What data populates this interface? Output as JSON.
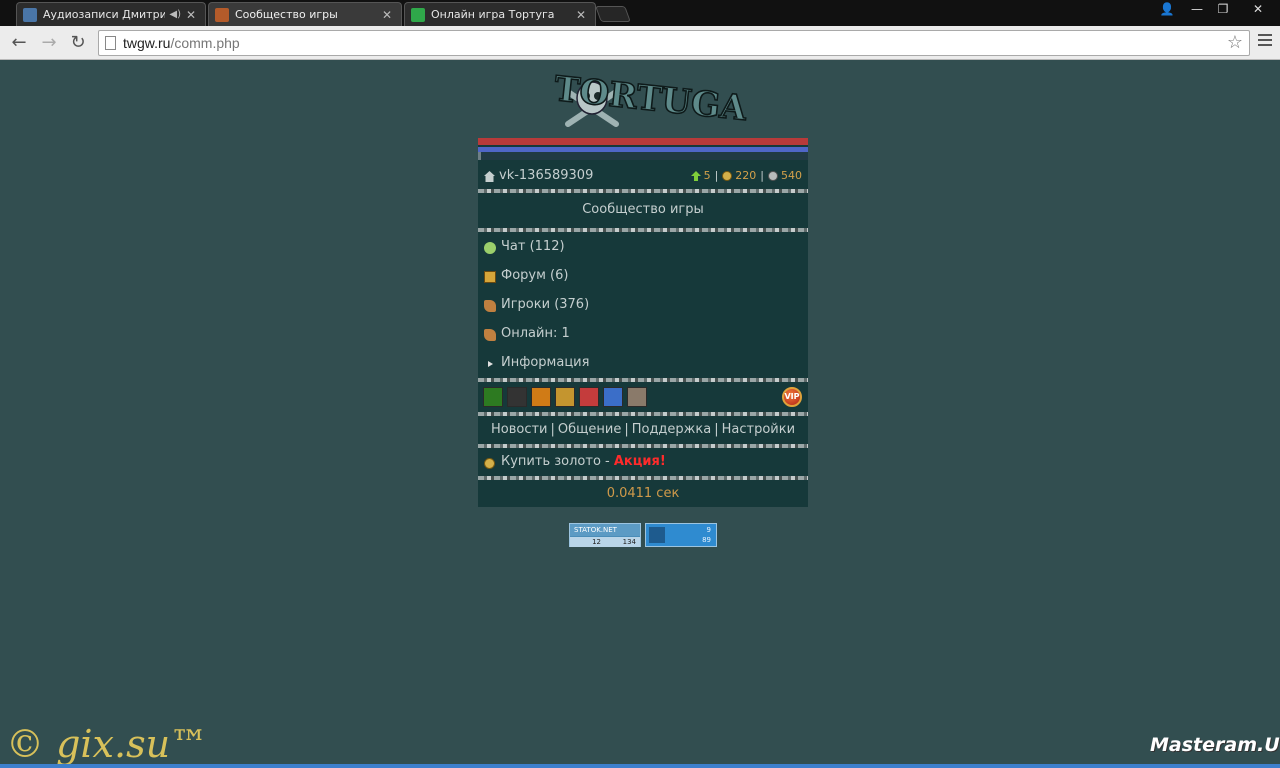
{
  "browser": {
    "tabs": [
      {
        "title": "Аудиозаписи Дмитрия К",
        "favicon_color": "#4a76a8",
        "active": false,
        "audio": true
      },
      {
        "title": "Сообщество игры",
        "favicon_color": "#b45b2a",
        "active": true,
        "audio": false
      },
      {
        "title": "Онлайн игра Тортуга",
        "favicon_color": "#2fa84a",
        "active": false,
        "audio": false
      }
    ],
    "close_glyph": "✕",
    "audio_glyph": "◀)",
    "url_domain": "twgw.ru",
    "url_path": "/comm.php",
    "window_controls": [
      "👤",
      "—",
      "❐",
      "✕"
    ]
  },
  "game": {
    "logo_text": "TORTUGA",
    "user": {
      "name": "vk-136589309",
      "level": "5",
      "gold": "220",
      "silver": "540"
    },
    "section_title": "Сообщество игры",
    "menu": [
      {
        "label": "Чат (112)",
        "icon": "chat-icon",
        "color": "#9bcf6b"
      },
      {
        "label": "Форум (6)",
        "icon": "forum-icon",
        "color": "#d6a63a"
      },
      {
        "label": "Игроки (376)",
        "icon": "scroll-icon",
        "color": "#c08040"
      },
      {
        "label": "Онлайн: 1",
        "icon": "scroll-icon",
        "color": "#c08040"
      },
      {
        "label": "Информация",
        "icon": "arrow-icon",
        "color": "#e0e0e0"
      }
    ],
    "badges": [
      {
        "name": "badge-green-warrior",
        "color": "#2d7a21"
      },
      {
        "name": "badge-pirate-skull",
        "color": "#333"
      },
      {
        "name": "badge-sun-orange",
        "color": "#d07b16"
      },
      {
        "name": "badge-gold-shield",
        "color": "#c4952f"
      },
      {
        "name": "badge-red-star",
        "color": "#c43c3c"
      },
      {
        "name": "badge-blue-star",
        "color": "#3b6ec8"
      },
      {
        "name": "badge-grey-face",
        "color": "#8a7a6a"
      }
    ],
    "vip_label": "VIP",
    "links": [
      "Новости",
      "Общение",
      "Поддержка",
      "Настройки"
    ],
    "link_separator": "|",
    "buy_gold": "Купить золото -",
    "promo": "Акция!",
    "timing": "0.0411 сек"
  },
  "counters": {
    "statok_label": "STATOK.NET",
    "statok_left": "12",
    "statok_right": "134",
    "counter2_top": "9",
    "counter2_bottom": "89"
  },
  "watermarks": {
    "left": "© gix.su™",
    "right": "Masteram.US"
  }
}
